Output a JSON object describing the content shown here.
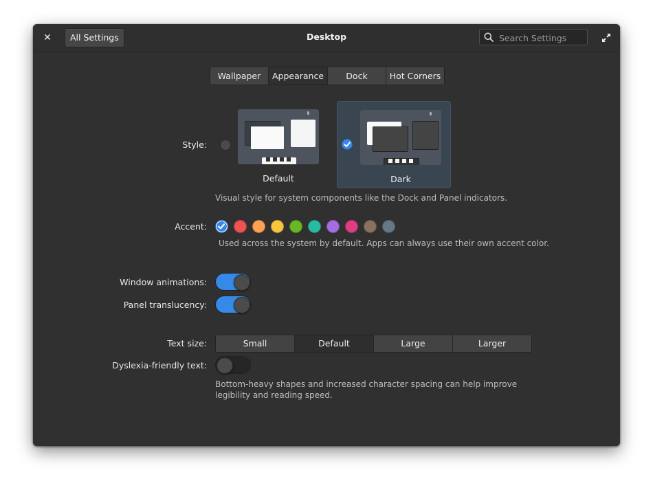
{
  "header": {
    "back_label": "All Settings",
    "title": "Desktop",
    "search_placeholder": "Search Settings"
  },
  "tabs": [
    {
      "label": "Wallpaper",
      "active": false
    },
    {
      "label": "Appearance",
      "active": true
    },
    {
      "label": "Dock",
      "active": false
    },
    {
      "label": "Hot Corners",
      "active": false
    }
  ],
  "style": {
    "label": "Style:",
    "options": [
      {
        "name": "Default",
        "selected": false
      },
      {
        "name": "Dark",
        "selected": true
      }
    ],
    "description": "Visual style for system components like the Dock and Panel indicators."
  },
  "accent": {
    "label": "Accent:",
    "colors": [
      "#3689e6",
      "#ed5353",
      "#ffa154",
      "#f9c440",
      "#68b723",
      "#28bca3",
      "#a56de2",
      "#de3e80",
      "#8a715e",
      "#667885"
    ],
    "selected_index": 0,
    "description": "Used across the system by default. Apps can always use their own accent color."
  },
  "toggles": {
    "window_animations": {
      "label": "Window animations:",
      "on": true
    },
    "panel_translucency": {
      "label": "Panel translucency:",
      "on": true
    }
  },
  "text_size": {
    "label": "Text size:",
    "options": [
      "Small",
      "Default",
      "Large",
      "Larger"
    ],
    "selected": "Default"
  },
  "dyslexia": {
    "label": "Dyslexia-friendly text:",
    "on": false,
    "description": "Bottom-heavy shapes and increased character spacing can help improve legibility and reading speed."
  }
}
